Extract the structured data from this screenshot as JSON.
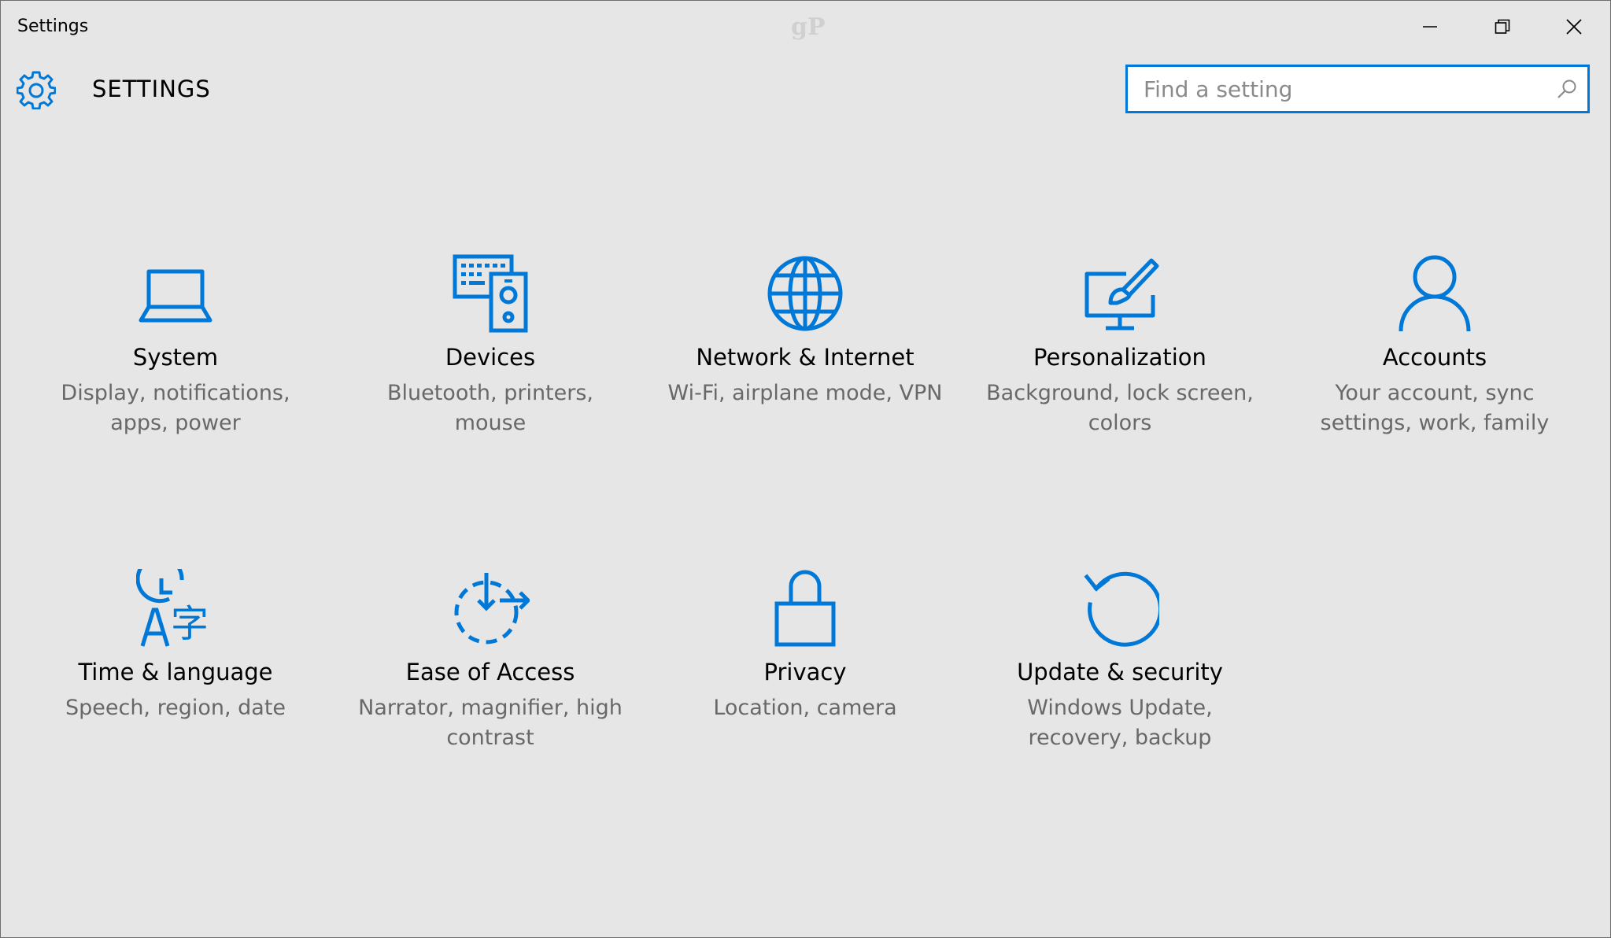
{
  "window": {
    "title": "Settings",
    "watermark": "gP"
  },
  "header": {
    "title": "SETTINGS",
    "gear_icon": "gear-icon"
  },
  "search": {
    "placeholder": "Find a setting",
    "value": "",
    "icon": "search-icon"
  },
  "colors": {
    "accent": "#0078d7",
    "background": "#e6e6e6",
    "description": "#686868"
  },
  "tiles": [
    {
      "title": "System",
      "description": "Display, notifications, apps, power",
      "icon": "laptop-icon"
    },
    {
      "title": "Devices",
      "description": "Bluetooth, printers, mouse",
      "icon": "devices-icon"
    },
    {
      "title": "Network & Internet",
      "description": "Wi-Fi, airplane mode, VPN",
      "icon": "globe-icon"
    },
    {
      "title": "Personalization",
      "description": "Background, lock screen, colors",
      "icon": "personalization-icon"
    },
    {
      "title": "Accounts",
      "description": "Your account, sync settings, work, family",
      "icon": "person-icon"
    },
    {
      "title": "Time & language",
      "description": "Speech, region, date",
      "icon": "time-language-icon"
    },
    {
      "title": "Ease of Access",
      "description": "Narrator, magnifier, high contrast",
      "icon": "ease-of-access-icon"
    },
    {
      "title": "Privacy",
      "description": "Location, camera",
      "icon": "lock-icon"
    },
    {
      "title": "Update & security",
      "description": "Windows Update, recovery, backup",
      "icon": "refresh-icon"
    }
  ]
}
